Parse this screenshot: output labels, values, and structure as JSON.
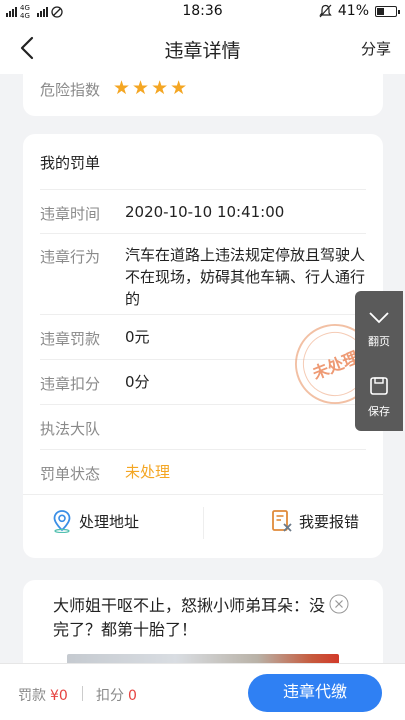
{
  "status_bar": {
    "network": "4G 4G",
    "time": "18:36",
    "battery": "41%",
    "battery_level": 0.41
  },
  "header": {
    "title": "违章详情",
    "share_label": "分享"
  },
  "risk": {
    "label": "危险指数",
    "stars": 4
  },
  "ticket": {
    "title": "我的罚单",
    "rows": [
      {
        "label": "违章时间",
        "value": "2020-10-10 10:41:00"
      },
      {
        "label": "违章行为",
        "value": "汽车在道路上违法规定停放且驾驶人不在现场，妨碍其他车辆、行人通行的"
      },
      {
        "label": "违章罚款",
        "value": "0元"
      },
      {
        "label": "违章扣分",
        "value": "0分"
      },
      {
        "label": "执法大队",
        "value": ""
      },
      {
        "label": "罚单状态",
        "value": "未处理"
      }
    ],
    "stamp_text": "未处理",
    "actions": {
      "address_label": "处理地址",
      "report_label": "我要报错"
    }
  },
  "side_actions": {
    "page_label": "翻页",
    "save_label": "保存"
  },
  "ad": {
    "text": "大师姐干呕不止，怒揪小师弟耳朵：没完了？都第十胎了！"
  },
  "bottom": {
    "fine_label": "罚款",
    "fine_value": "¥0",
    "points_label": "扣分",
    "points_value": "0",
    "pay_label": "违章代缴"
  },
  "colors": {
    "accent": "#2f80f3",
    "star": "#f4a623",
    "status_orange": "#f4a623",
    "red": "#e64340"
  }
}
